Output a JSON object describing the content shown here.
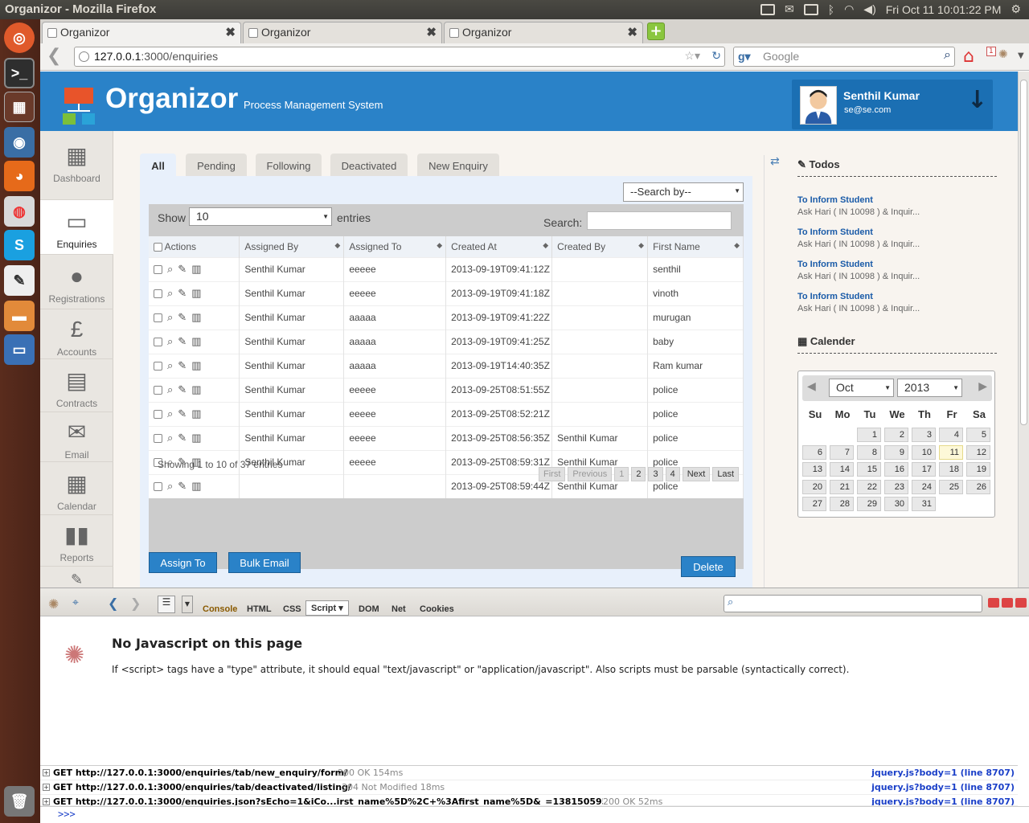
{
  "os": {
    "window_title": "Organizor - Mozilla Firefox",
    "clock": "Fri Oct 11  10:01:22 PM"
  },
  "browser": {
    "tabs": [
      {
        "label": "Organizor",
        "active": true
      },
      {
        "label": "Organizor",
        "active": false
      },
      {
        "label": "Organizor",
        "active": false
      }
    ],
    "url_host": "127.0.0.1",
    "url_path": ":3000/enquiries",
    "search_placeholder": "Google",
    "badge": "1"
  },
  "app": {
    "title": "Organizor",
    "subtitle": "Process Management System",
    "user_name": "Senthil Kumar",
    "user_email": "se@se.com"
  },
  "sidebar": {
    "items": [
      {
        "label": "Dashboard",
        "icon": "presentation-icon"
      },
      {
        "label": "Enquiries",
        "icon": "window-icon"
      },
      {
        "label": "Registrations",
        "icon": "user-icon"
      },
      {
        "label": "Accounts",
        "icon": "pound-icon"
      },
      {
        "label": "Contracts",
        "icon": "document-icon"
      },
      {
        "label": "Email",
        "icon": "envelope-icon"
      },
      {
        "label": "Calendar",
        "icon": "calendar-icon"
      },
      {
        "label": "Reports",
        "icon": "bar-chart-icon"
      }
    ]
  },
  "tabs": [
    "All",
    "Pending",
    "Following",
    "Deactivated",
    "New Enquiry"
  ],
  "table": {
    "search_by": "--Search by--",
    "show_label": "Show",
    "show_value": "10",
    "entries_label": "entries",
    "search_label": "Search:",
    "columns": [
      "Actions",
      "Assigned By",
      "Assigned To",
      "Created At",
      "Created By",
      "First Name"
    ],
    "rows": [
      [
        "Senthil Kumar",
        "eeeee",
        "2013-09-19T09:41:12Z",
        "",
        "senthil"
      ],
      [
        "Senthil Kumar",
        "eeeee",
        "2013-09-19T09:41:18Z",
        "",
        "vinoth"
      ],
      [
        "Senthil Kumar",
        "aaaaa",
        "2013-09-19T09:41:22Z",
        "",
        "murugan"
      ],
      [
        "Senthil Kumar",
        "aaaaa",
        "2013-09-19T09:41:25Z",
        "",
        "baby"
      ],
      [
        "Senthil Kumar",
        "aaaaa",
        "2013-09-19T14:40:35Z",
        "",
        "Ram kumar"
      ],
      [
        "Senthil Kumar",
        "eeeee",
        "2013-09-25T08:51:55Z",
        "",
        "police"
      ],
      [
        "Senthil Kumar",
        "eeeee",
        "2013-09-25T08:52:21Z",
        "",
        "police"
      ],
      [
        "Senthil Kumar",
        "eeeee",
        "2013-09-25T08:56:35Z",
        "Senthil Kumar",
        "police"
      ],
      [
        "Senthil Kumar",
        "eeeee",
        "2013-09-25T08:59:31Z",
        "Senthil Kumar",
        "police"
      ],
      [
        "",
        "",
        "2013-09-25T08:59:44Z",
        "Senthil Kumar",
        "police"
      ]
    ],
    "showing": "Showing 1 to 10 of 37 entries",
    "pager": [
      "First",
      "Previous",
      "1",
      "2",
      "3",
      "4",
      "Next",
      "Last"
    ]
  },
  "buttons": {
    "assign_to": "Assign To",
    "bulk_email": "Bulk Email",
    "delete": "Delete"
  },
  "todos": {
    "heading": "Todos",
    "items": [
      {
        "title": "To Inform Student",
        "desc": "Ask Hari ( IN 10098 ) & Inquir..."
      },
      {
        "title": "To Inform Student",
        "desc": "Ask Hari ( IN 10098 ) & Inquir..."
      },
      {
        "title": "To Inform Student",
        "desc": "Ask Hari ( IN 10098 ) & Inquir..."
      },
      {
        "title": "To Inform Student",
        "desc": "Ask Hari ( IN 10098 ) & Inquir..."
      }
    ]
  },
  "calendar": {
    "heading": "Calender",
    "month": "Oct",
    "year": "2013",
    "dow": [
      "Su",
      "Mo",
      "Tu",
      "We",
      "Th",
      "Fr",
      "Sa"
    ],
    "today": "11"
  },
  "firebug": {
    "tabs": [
      "Console",
      "HTML",
      "CSS",
      "Script",
      "DOM",
      "Net",
      "Cookies"
    ],
    "title": "No Javascript on this page",
    "message": "If <script> tags have a \"type\" attribute, it should equal \"text/javascript\" or \"application/javascript\". Also scripts must be parsable (syntactically correct).",
    "net": [
      {
        "req": "GET http://127.0.0.1:3000/enquiries/tab/new_enquiry/form/",
        "status": "200 OK 154ms",
        "src": "jquery.js?body=1 (line 8707)"
      },
      {
        "req": "GET http://127.0.0.1:3000/enquiries/tab/deactivated/listing/",
        "status": "304 Not Modified 18ms",
        "src": "jquery.js?body=1 (line 8707)"
      },
      {
        "req": "GET http://127.0.0.1:3000/enquiries.json?sEcho=1&iCo...irst_name%5D%2C+%3Afirst_name%5D&_=1381505952467",
        "status": "200 OK 52ms",
        "src": "jquery.js?body=1 (line 8707)"
      }
    ],
    "prompt": ">>>"
  }
}
